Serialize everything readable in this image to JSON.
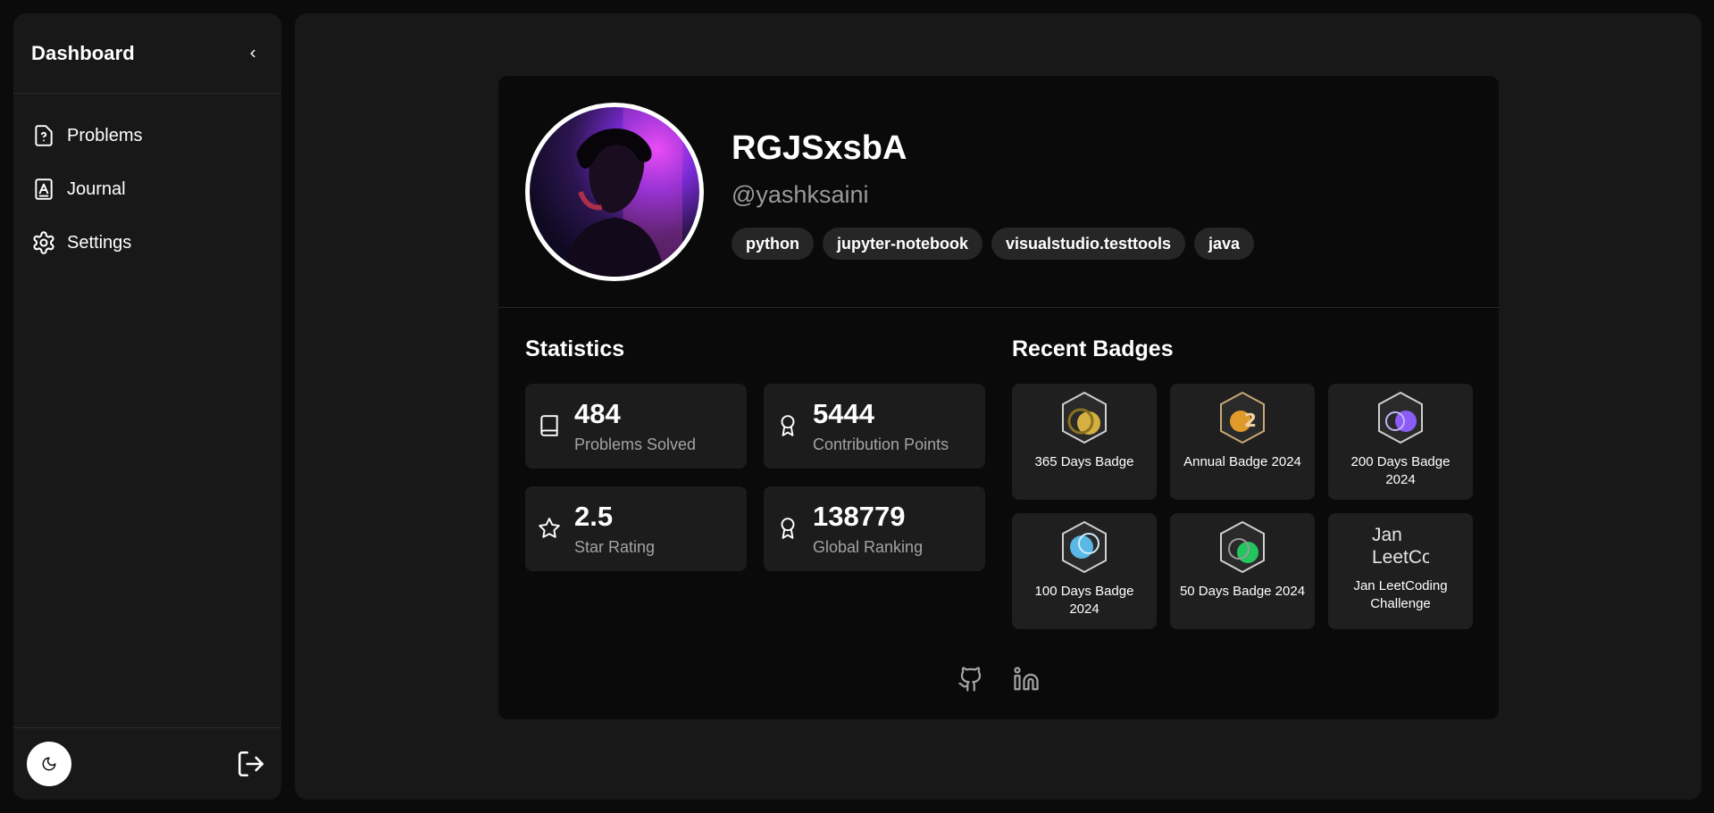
{
  "sidebar": {
    "title": "Dashboard",
    "nav": [
      {
        "label": "Problems",
        "icon": "file-question-icon"
      },
      {
        "label": "Journal",
        "icon": "contact-book-icon"
      },
      {
        "label": "Settings",
        "icon": "gear-icon"
      }
    ]
  },
  "profile": {
    "name": "RGJSxsbA",
    "handle": "@yashksaini",
    "tags": [
      "python",
      "jupyter-notebook",
      "visualstudio.testtools",
      "java"
    ]
  },
  "statistics": {
    "title": "Statistics",
    "items": [
      {
        "value": "484",
        "label": "Problems Solved",
        "icon": "book-icon"
      },
      {
        "value": "5444",
        "label": "Contribution Points",
        "icon": "award-icon"
      },
      {
        "value": "2.5",
        "label": "Star Rating",
        "icon": "star-icon"
      },
      {
        "value": "138779",
        "label": "Global Ranking",
        "icon": "award-icon"
      }
    ]
  },
  "badges": {
    "title": "Recent Badges",
    "items": [
      {
        "name": "365 Days Badge",
        "color": "#d4b040"
      },
      {
        "name": "Annual Badge 2024",
        "color": "#e09a2a"
      },
      {
        "name": "200 Days Badge 2024",
        "color": "#8b5cf6"
      },
      {
        "name": "100 Days Badge 2024",
        "color": "#5ab8e6"
      },
      {
        "name": "50 Days Badge 2024",
        "color": "#22c55e"
      },
      {
        "name": "Jan LeetCoding Challenge",
        "alt": "Jan LeetCo",
        "broken": true
      }
    ]
  },
  "socials": [
    {
      "icon": "github-icon"
    },
    {
      "icon": "linkedin-icon"
    }
  ]
}
